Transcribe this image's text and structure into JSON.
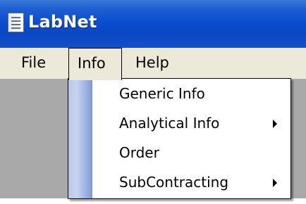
{
  "window": {
    "title": "LabNet",
    "icon": "notepad-icon"
  },
  "menubar": {
    "items": [
      {
        "label": "File"
      },
      {
        "label": "Info"
      },
      {
        "label": "Help"
      }
    ],
    "open_menu": "Info"
  },
  "info_menu": {
    "items": [
      {
        "label": "Generic Info",
        "submenu": false
      },
      {
        "label": "Analytical Info",
        "submenu": true,
        "icon": "submenu-arrow-icon"
      },
      {
        "label": "Order",
        "submenu": false
      },
      {
        "label": "SubContracting",
        "submenu": true,
        "icon": "submenu-arrow-icon"
      }
    ]
  },
  "colors": {
    "titlebar": "#0b4ed0",
    "menubar": "#ece9d8",
    "workspace": "#a9a9a9",
    "menu_gutter": "#7d9ad6"
  }
}
